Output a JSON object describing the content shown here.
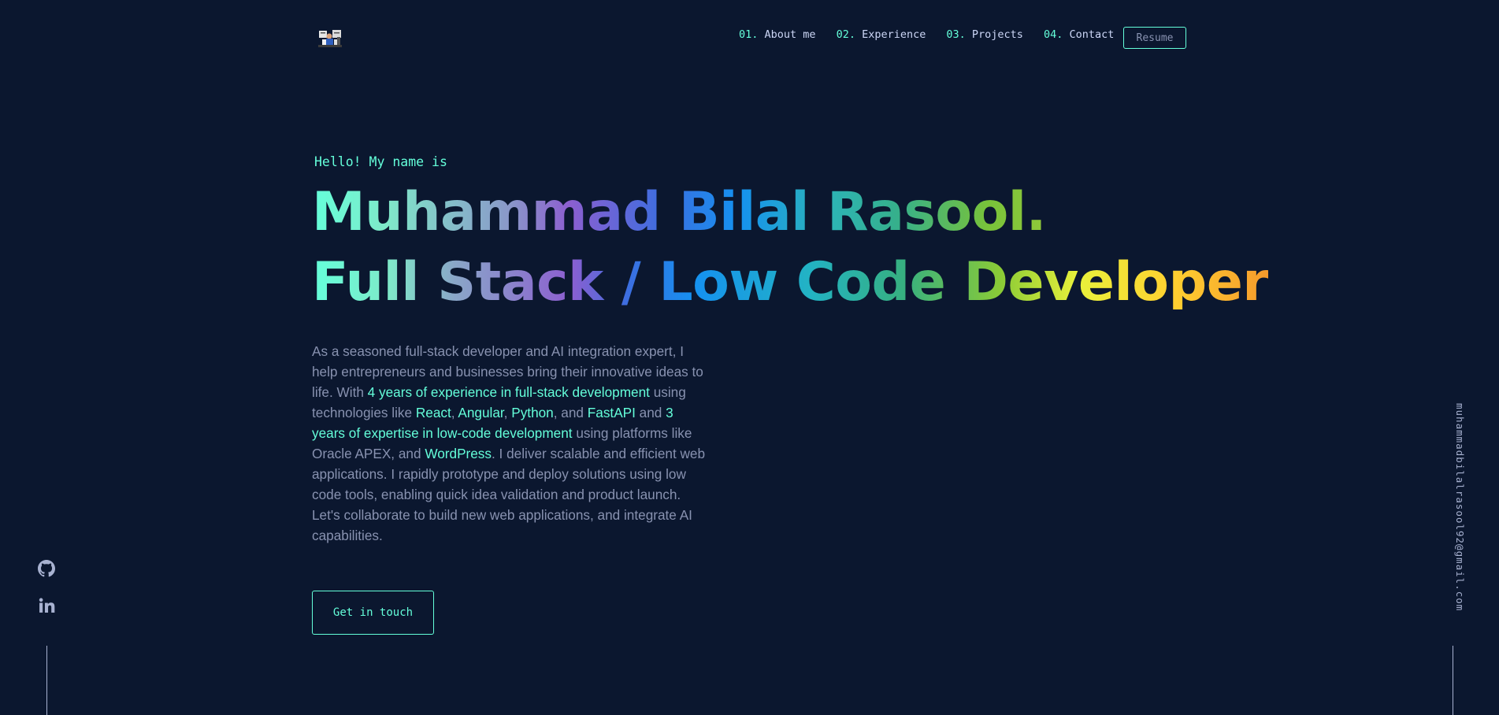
{
  "nav": {
    "items": [
      {
        "num": "01.",
        "label": "About me"
      },
      {
        "num": "02.",
        "label": "Experience"
      },
      {
        "num": "03.",
        "label": "Projects"
      },
      {
        "num": "04.",
        "label": "Contact"
      }
    ],
    "resume_label": "Resume"
  },
  "hero": {
    "greeting": "Hello! My name is",
    "name": "Muhammad Bilal Rasool.",
    "role": "Full Stack / Low Code Developer",
    "bio": {
      "p1": "As a seasoned full-stack developer and AI integration expert, I help entrepreneurs and businesses bring their innovative ideas to life. With ",
      "h1": "4 years of experience in full-stack development",
      "p2": " using technologies like ",
      "h2": "React",
      "p3": ", ",
      "h3": "Angular",
      "p4": ", ",
      "h4": "Python",
      "p5": ", and ",
      "h5": "FastAPI",
      "p6": " and ",
      "h6": "3 years of expertise in low-code development",
      "p7": " using platforms like Oracle APEX, and ",
      "h7": "WordPress",
      "p8": ". I deliver scalable and efficient web applications. I rapidly prototype and deploy solutions using low code tools, enabling quick idea validation and product launch. Let's collaborate to build new web applications, and integrate AI capabilities."
    },
    "cta_label": "Get in touch"
  },
  "email": "muhammadbilalrasool92@gmail.com",
  "icons": {
    "logo": "avatar-logo-icon",
    "github": "github-icon",
    "linkedin": "linkedin-icon"
  },
  "colors": {
    "background": "#0b172f",
    "accent": "#64ffda",
    "text_muted": "#8892b0",
    "text_light": "#ccd6f6"
  }
}
